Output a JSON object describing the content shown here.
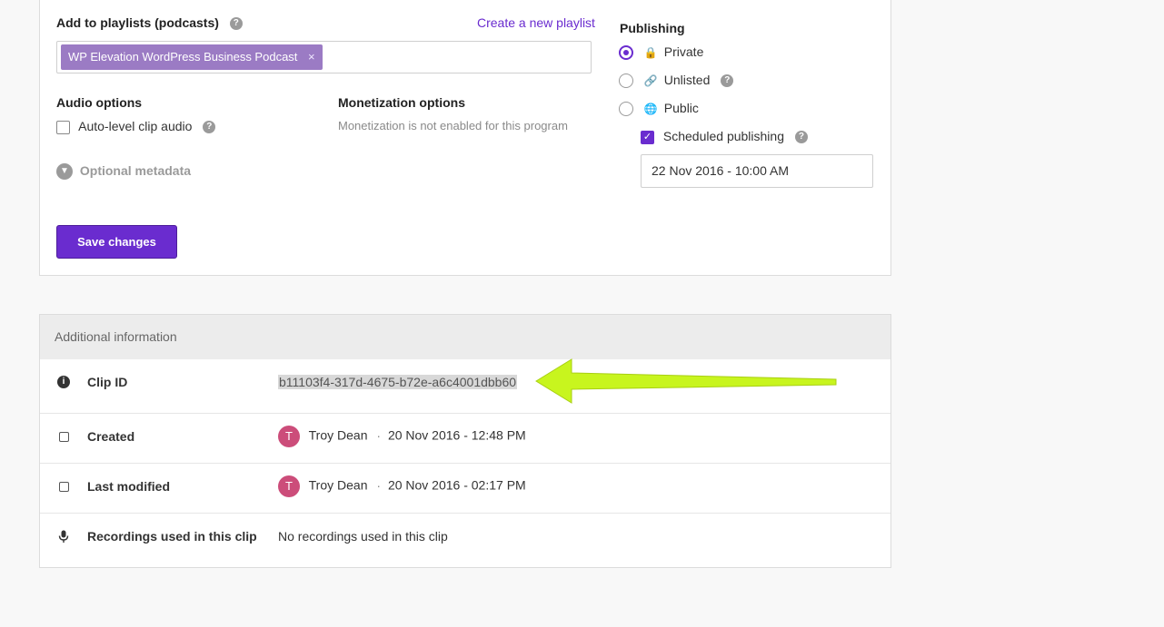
{
  "playlists": {
    "label": "Add to playlists (podcasts)",
    "create_link": "Create a new playlist",
    "selected_tag": "WP Elevation WordPress Business Podcast",
    "tag_remove": "×"
  },
  "audio_options": {
    "label": "Audio options",
    "auto_level": "Auto-level clip audio"
  },
  "monetization": {
    "label": "Monetization options",
    "note": "Monetization is not enabled for this program"
  },
  "optional_metadata": "Optional metadata",
  "save_button": "Save changes",
  "publishing": {
    "label": "Publishing",
    "private": "Private",
    "unlisted": "Unlisted",
    "public": "Public",
    "scheduled": "Scheduled publishing",
    "scheduled_date": "22 Nov 2016 - 10:00 AM",
    "selected": "private",
    "scheduled_checked": true
  },
  "additional_info": {
    "header": "Additional information",
    "clip_id_label": "Clip ID",
    "clip_id_value": "b11103f4-317d-4675-b72e-a6c4001dbb60",
    "created_label": "Created",
    "created_user": "Troy Dean",
    "created_date": "20 Nov 2016 - 12:48 PM",
    "modified_label": "Last modified",
    "modified_user": "Troy Dean",
    "modified_date": "20 Nov 2016 - 02:17 PM",
    "recordings_label": "Recordings used in this clip",
    "recordings_value": "No recordings used in this clip",
    "avatar_initial": "T"
  },
  "colors": {
    "accent": "#6a2ccf",
    "tag": "#9b7bc4",
    "avatar": "#cc4d7a",
    "arrow": "#c8f51e"
  }
}
